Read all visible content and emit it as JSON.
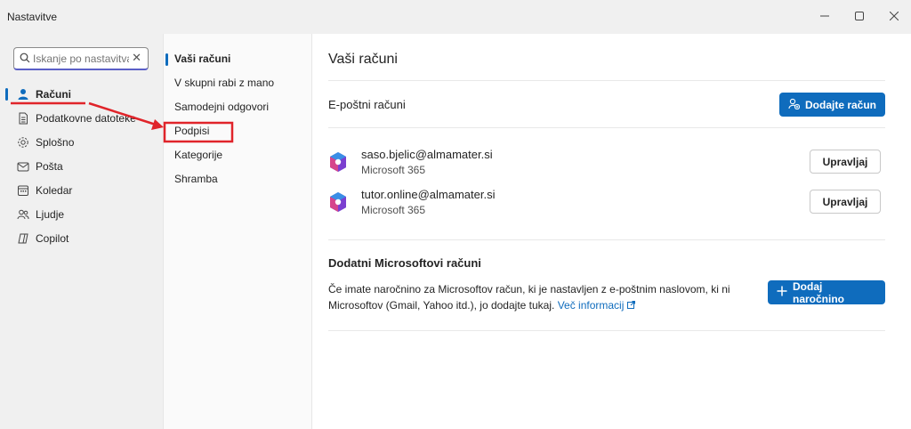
{
  "window": {
    "title": "Nastavitve"
  },
  "colors": {
    "accent": "#0f6cbd",
    "annotation": "#e0242a"
  },
  "search": {
    "placeholder": "Iskanje po nastavitvah",
    "value": ""
  },
  "sidebar": {
    "items": [
      {
        "label": "Računi",
        "icon": "person-icon",
        "active": true
      },
      {
        "label": "Podatkovne datoteke",
        "icon": "data-file-icon"
      },
      {
        "label": "Splošno",
        "icon": "gear-icon"
      },
      {
        "label": "Pošta",
        "icon": "mail-icon"
      },
      {
        "label": "Koledar",
        "icon": "calendar-icon"
      },
      {
        "label": "Ljudje",
        "icon": "people-icon"
      },
      {
        "label": "Copilot",
        "icon": "copilot-icon"
      }
    ]
  },
  "subnav": {
    "items": [
      {
        "label": "Vaši računi",
        "active": true
      },
      {
        "label": "V skupni rabi z mano"
      },
      {
        "label": "Samodejni odgovori"
      },
      {
        "label": "Podpisi",
        "highlighted": true
      },
      {
        "label": "Kategorije"
      },
      {
        "label": "Shramba"
      }
    ]
  },
  "main": {
    "title": "Vaši računi",
    "email_section": {
      "heading": "E-poštni računi",
      "add_button": "Dodajte račun",
      "accounts": [
        {
          "email": "saso.bjelic@almamater.si",
          "type": "Microsoft 365",
          "manage": "Upravljaj"
        },
        {
          "email": "tutor.online@almamater.si",
          "type": "Microsoft 365",
          "manage": "Upravljaj"
        }
      ]
    },
    "extra_section": {
      "heading": "Dodatni Microsoftovi računi",
      "text": "Če imate naročnino za Microsoftov račun, ki je nastavljen z e-poštnim naslovom, ki ni Microsoftov (Gmail, Yahoo itd.), jo dodajte tukaj.",
      "link": "Več informacij",
      "add_button": "Dodaj naročnino"
    }
  }
}
